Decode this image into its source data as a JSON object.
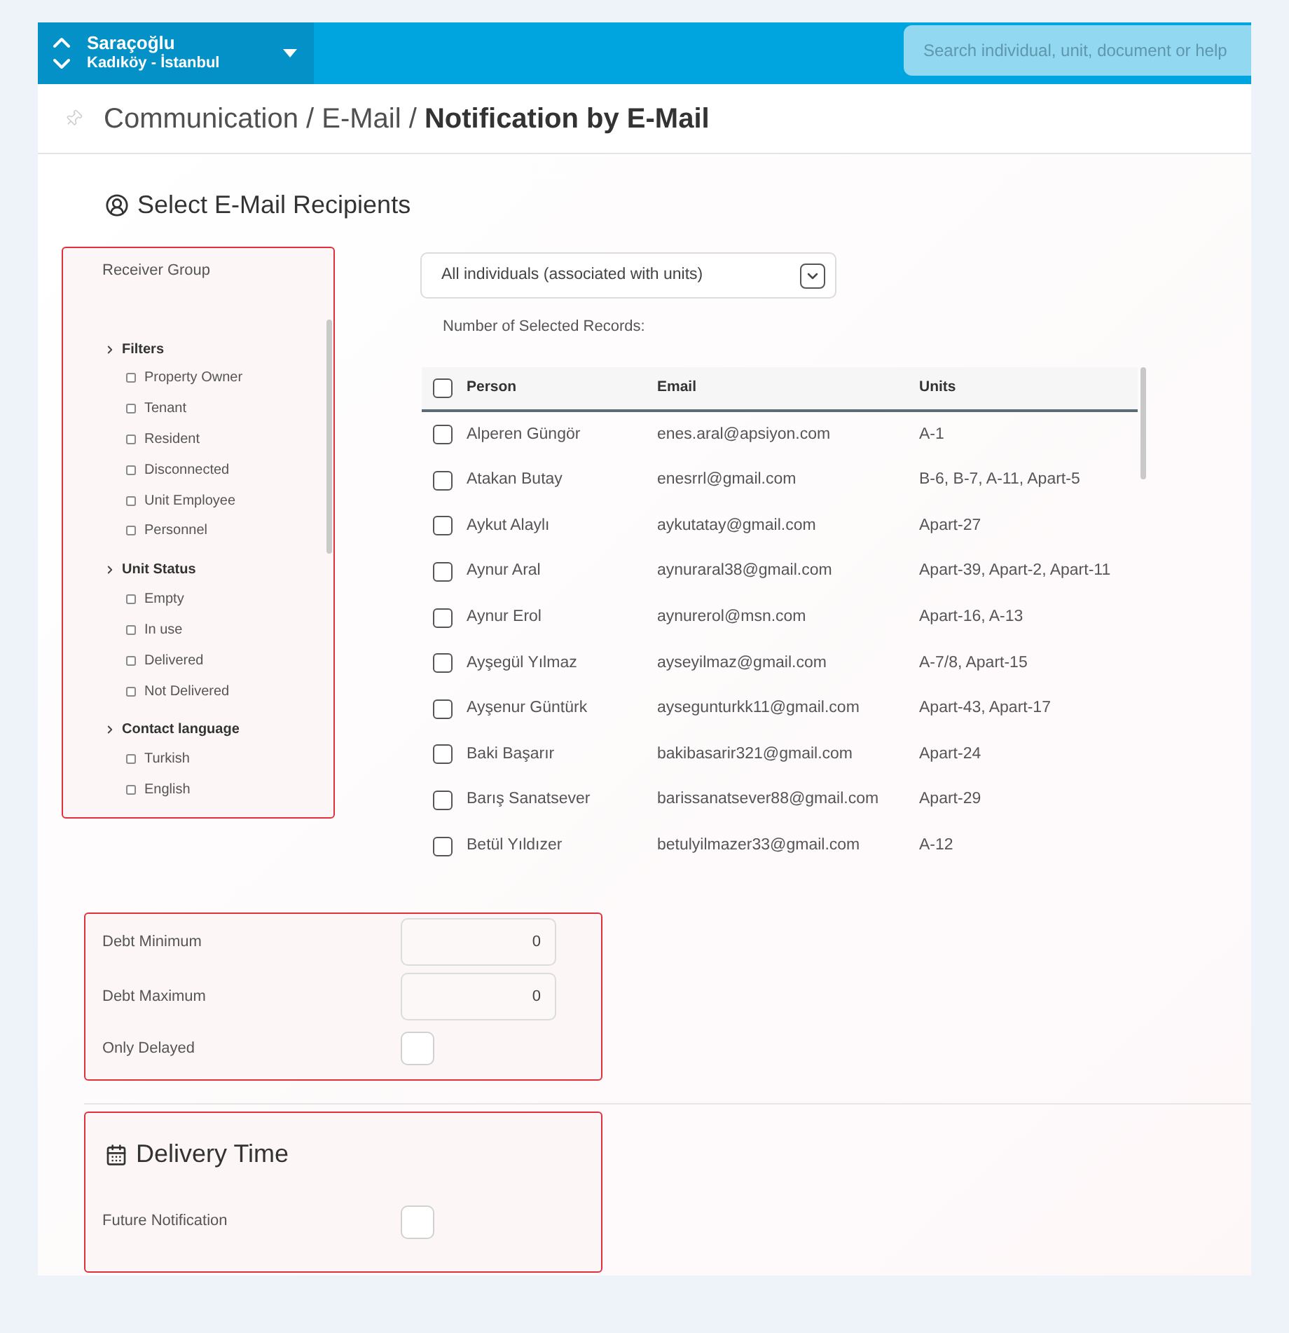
{
  "top_bar": {
    "location": {
      "name": "Saraçoğlu",
      "district": "Kadıköy - İstanbul"
    },
    "search": {
      "placeholder": "Search individual, unit, document or help"
    }
  },
  "breadcrumb": "Communication / E-Mail / **Notification by E-Mail**",
  "recipients": {
    "title": "Select E-Mail Recipients",
    "receiver_group": {
      "label": "Receiver Group",
      "groups": [
        {
          "label": "Filters",
          "options": [
            {
              "label": "Property Owner",
              "checked": false
            },
            {
              "label": "Tenant",
              "checked": false
            },
            {
              "label": "Resident",
              "checked": false
            },
            {
              "label": "Disconnected",
              "checked": false
            },
            {
              "label": "Unit Employee",
              "checked": false
            },
            {
              "label": "Personnel",
              "checked": false
            }
          ]
        },
        {
          "label": "Unit Status",
          "options": [
            {
              "label": "Empty",
              "checked": false
            },
            {
              "label": "In use",
              "checked": false
            },
            {
              "label": "Delivered",
              "checked": false
            },
            {
              "label": "Not Delivered",
              "checked": false
            }
          ]
        },
        {
          "label": "Contact language",
          "options": [
            {
              "label": "Turkish",
              "checked": false
            },
            {
              "label": "English",
              "checked": false
            }
          ]
        }
      ]
    },
    "dropdown": {
      "value": "All individuals (associated with units)"
    },
    "selected_count": {
      "label": "Number of Selected Records:"
    },
    "table": {
      "columns": [
        "Person",
        "Email",
        "Units"
      ],
      "select_all": {
        "checked": false
      },
      "rows": [
        {
          "person": "Alperen Güngör",
          "email": "enes.aral@apsiyon.com",
          "units": "A-1",
          "selected": false
        },
        {
          "person": "Atakan Butay",
          "email": "enesrrl@gmail.com",
          "units": "B-6, B-7, A-11, Apart-5",
          "selected": false
        },
        {
          "person": "Aykut Alaylı",
          "email": "aykutatay@gmail.com",
          "units": "Apart-27",
          "selected": false
        },
        {
          "person": "Aynur Aral",
          "email": "aynuraral38@gmail.com",
          "units": "Apart-39, Apart-2, Apart-11",
          "selected": false
        },
        {
          "person": "Aynur Erol",
          "email": "aynurerol@msn.com",
          "units": "Apart-16, A-13",
          "selected": false
        },
        {
          "person": "Ayşegül Yılmaz",
          "email": "ayseyilmaz@gmail.com",
          "units": "A-7/8, Apart-15",
          "selected": false
        },
        {
          "person": "Ayşenur Güntürk",
          "email": "aysegunturkk11@gmail.com",
          "units": "Apart-43, Apart-17",
          "selected": false
        },
        {
          "person": "Baki Başarır",
          "email": "bakibasarir321@gmail.com",
          "units": "Apart-24",
          "selected": false
        },
        {
          "person": "Barış Sanatsever",
          "email": "barissanatsever88@gmail.com",
          "units": "Apart-29",
          "selected": false
        },
        {
          "person": "Betül Yıldızer",
          "email": "betulyilmazer33@gmail.com",
          "units": "A-12",
          "selected": false
        }
      ]
    }
  },
  "debt": {
    "fields": [
      {
        "label": "Debt Minimum",
        "value": "0"
      },
      {
        "label": "Debt Maximum",
        "value": "0"
      }
    ],
    "only_delayed": {
      "label": "Only Delayed",
      "checked": false
    }
  },
  "delivery_time": {
    "title": "Delivery Time",
    "future_notification": {
      "label": "Future Notification",
      "checked": false
    }
  }
}
